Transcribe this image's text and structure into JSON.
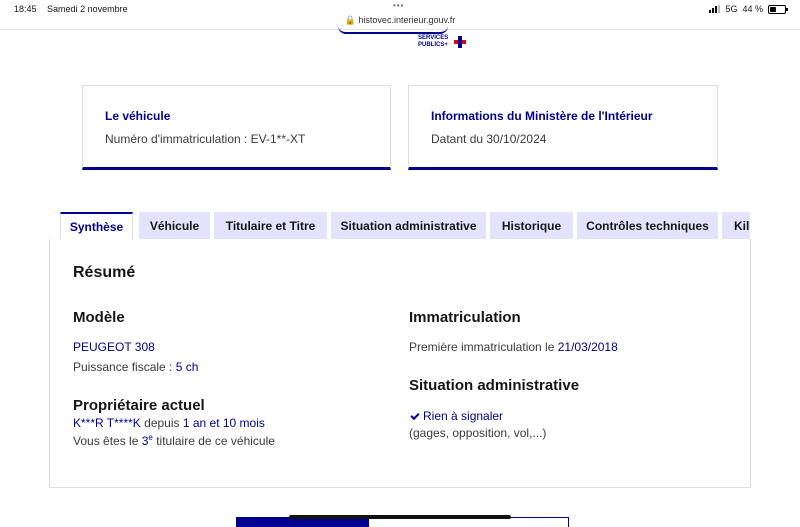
{
  "status_bar": {
    "time": "18:45",
    "date": "Samedi 2 novembre",
    "url": "histovec.interieur.gouv.fr",
    "network": "5G",
    "battery": "44 %",
    "battery_level": 0.44
  },
  "brand": {
    "line1": "SERVICES",
    "line2": "PUBLICS+"
  },
  "cards": [
    {
      "title": "Le véhicule",
      "subtitle": "Numéro d'immatriculation : EV-1**-XT"
    },
    {
      "title": "Informations du Ministère de l'Intérieur",
      "subtitle": "Datant du 30/10/2024"
    }
  ],
  "tabs": [
    {
      "label": "Synthèse",
      "active": true
    },
    {
      "label": "Véhicule"
    },
    {
      "label": "Titulaire et Titre"
    },
    {
      "label": "Situation administrative"
    },
    {
      "label": "Historique"
    },
    {
      "label": "Contrôles techniques"
    },
    {
      "label": "Kil"
    }
  ],
  "summary": {
    "heading": "Résumé",
    "model": {
      "heading": "Modèle",
      "name": "PEUGEOT 308",
      "power_label": "Puissance fiscale : ",
      "power_value": "5 ch"
    },
    "owner": {
      "heading": "Propriétaire actuel",
      "name": "K***R T****K",
      "since_label": " depuis ",
      "since_value": "1 an et 10 mois",
      "rank_prefix": "Vous êtes le ",
      "rank_value": "3",
      "rank_sup": "e",
      "rank_suffix": " titulaire de ce véhicule"
    },
    "registration": {
      "heading": "Immatriculation",
      "first_label": "Première immatriculation le ",
      "first_date": "21/03/2018"
    },
    "admin": {
      "heading": "Situation administrative",
      "status": "Rien à signaler",
      "details": "(gages, opposition, vol,...)"
    }
  }
}
